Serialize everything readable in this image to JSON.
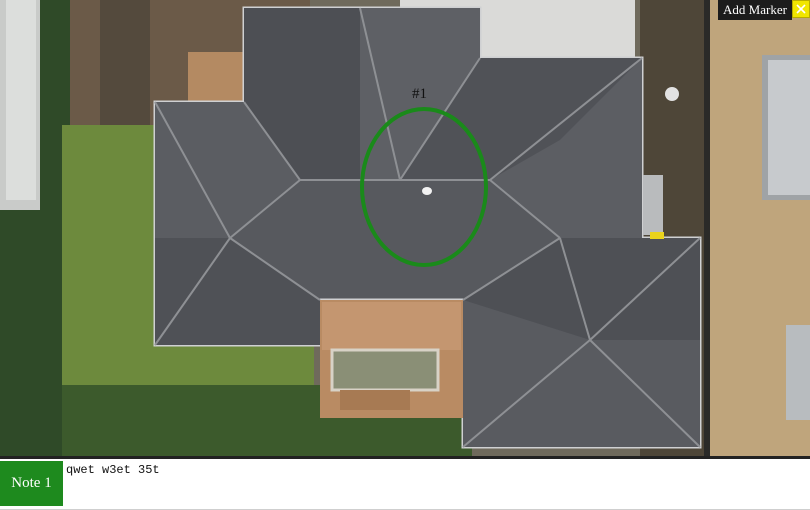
{
  "toolbar": {
    "add_marker_label": "Add Marker",
    "close_icon": "close-icon"
  },
  "markers": [
    {
      "label": "#1",
      "shape": "ellipse",
      "color": "#1a8a1a"
    }
  ],
  "notes": [
    {
      "tab_label": "Note 1",
      "text": "qwet w3et 35t"
    }
  ],
  "colors": {
    "marker": "#1a8a1a",
    "note_tab": "#1e8a1e",
    "toolbar_bg": "#1c1c1c",
    "close_bg": "#f1e600",
    "roof": "#5a5c61"
  }
}
